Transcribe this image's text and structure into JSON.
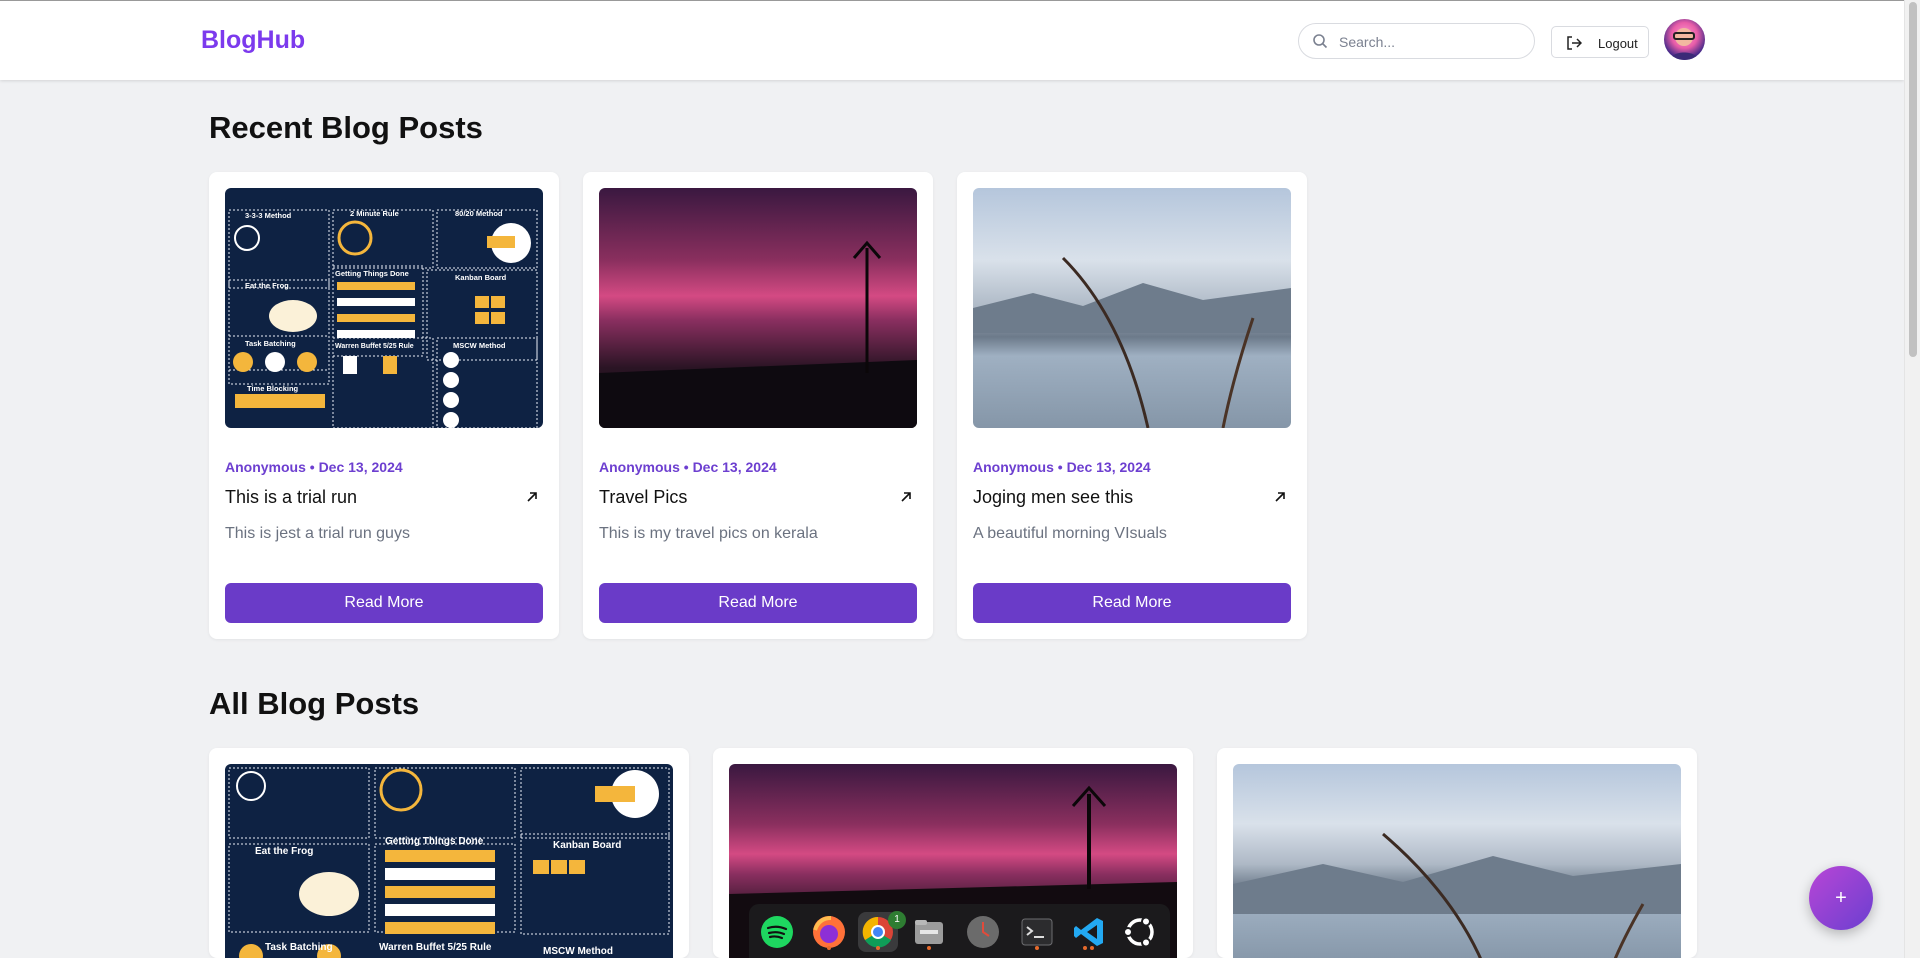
{
  "header": {
    "logo": "BlogHub",
    "search_placeholder": "Search...",
    "logout_label": "Logout"
  },
  "recent": {
    "title": "Recent Blog Posts",
    "posts": [
      {
        "meta": "Anonymous • Dec 13, 2024",
        "title": "This is a trial run",
        "description": "This is jest a trial run guys",
        "read_more": "Read More"
      },
      {
        "meta": "Anonymous • Dec 13, 2024",
        "title": "Travel Pics",
        "description": "This is my travel pics on kerala",
        "read_more": "Read More"
      },
      {
        "meta": "Anonymous • Dec 13, 2024",
        "title": "Joging men see this",
        "description": "A beautiful morning VIsuals",
        "read_more": "Read More"
      }
    ]
  },
  "all": {
    "title": "All Blog Posts"
  },
  "infographic": {
    "labels": [
      "3-3-3 Method",
      "2 Minute Rule",
      "80/20 Method",
      "Eat the Frog",
      "Getting Things Done",
      "Kanban Board",
      "Task Batching",
      "Warren Buffet 5/25 Rule",
      "MSCW Method",
      "Time Blocking"
    ]
  },
  "fab_label": "+",
  "dock": {
    "apps": [
      "spotify-icon",
      "firefox-icon",
      "chrome-icon",
      "files-icon",
      "clock-icon",
      "terminal-icon",
      "vscode-icon",
      "ubuntu-icon"
    ],
    "chrome_badge": "1"
  },
  "colors": {
    "brand": "#7c3aed",
    "button": "#6a3bc8",
    "background": "#f0f1f3"
  }
}
